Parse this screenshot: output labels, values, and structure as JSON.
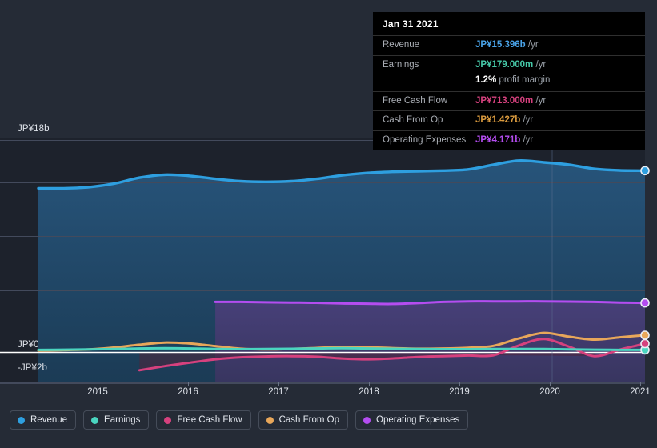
{
  "chart_data": {
    "type": "area",
    "title": "",
    "currency_prefix": "JP¥",
    "xlabel": "",
    "ylabel": "",
    "grid": true,
    "legend_position": "bottom-left",
    "x_tick_labels": [
      "2015",
      "2016",
      "2017",
      "2018",
      "2019",
      "2020",
      "2021"
    ],
    "y_tick_labels": [
      "JP¥18b",
      "JP¥0",
      "-JP¥2b"
    ],
    "ylim": [
      -2,
      18
    ],
    "y_unit": "JP¥ billions",
    "series": [
      {
        "name": "Revenue",
        "color": "#2e9fe0",
        "end_value": 15.396,
        "end_value_label": "JP¥15.396b",
        "values": [
          13.9,
          13.9,
          14.0,
          14.3,
          14.8,
          15.05,
          14.95,
          14.7,
          14.5,
          14.45,
          14.5,
          14.7,
          15.0,
          15.2,
          15.3,
          15.35,
          15.4,
          15.5,
          15.9,
          16.25,
          16.1,
          15.9,
          15.55,
          15.42,
          15.396
        ]
      },
      {
        "name": "Earnings",
        "color": "#4ad5c0",
        "end_value": 0.179,
        "end_value_label": "JP¥179.000m",
        "values": [
          0.18,
          0.2,
          0.22,
          0.25,
          0.3,
          0.32,
          0.3,
          0.26,
          0.24,
          0.25,
          0.27,
          0.3,
          0.32,
          0.3,
          0.27,
          0.25,
          0.24,
          0.24,
          0.25,
          0.26,
          0.25,
          0.22,
          0.2,
          0.18,
          0.179
        ]
      },
      {
        "name": "Free Cash Flow",
        "color": "#d6417e",
        "end_value": 0.713,
        "end_value_label": "JP¥713.000m",
        "start_x_index": 4,
        "values": [
          null,
          null,
          null,
          null,
          -1.55,
          -1.2,
          -0.9,
          -0.62,
          -0.45,
          -0.38,
          -0.35,
          -0.4,
          -0.55,
          -0.62,
          -0.55,
          -0.42,
          -0.35,
          -0.3,
          -0.28,
          0.55,
          1.1,
          0.45,
          -0.35,
          0.2,
          0.713
        ]
      },
      {
        "name": "Cash From Op",
        "color": "#e8a75a",
        "end_value": 1.427,
        "end_value_label": "JP¥1.427b",
        "values": [
          0.12,
          0.16,
          0.22,
          0.38,
          0.62,
          0.8,
          0.72,
          0.5,
          0.28,
          0.22,
          0.26,
          0.34,
          0.42,
          0.4,
          0.33,
          0.28,
          0.3,
          0.36,
          0.52,
          1.15,
          1.62,
          1.3,
          1.05,
          1.25,
          1.427
        ]
      },
      {
        "name": "Operating Expenses",
        "color": "#b44df0",
        "end_value": 4.171,
        "end_value_label": "JP¥4.171b",
        "start_x_index": 7,
        "values": [
          null,
          null,
          null,
          null,
          null,
          null,
          null,
          4.25,
          4.25,
          4.22,
          4.2,
          4.18,
          4.12,
          4.1,
          4.08,
          4.15,
          4.25,
          4.3,
          4.3,
          4.3,
          4.3,
          4.28,
          4.25,
          4.2,
          4.171
        ]
      }
    ]
  },
  "tooltip": {
    "title": "Jan 31 2021",
    "rows": [
      {
        "label": "Revenue",
        "amount": "JP¥15.396b",
        "unit": "/yr",
        "color": "#4aa3e8"
      },
      {
        "label": "Earnings",
        "amount": "JP¥179.000m",
        "unit": "/yr",
        "color": "#46c8a8"
      },
      {
        "label": "Free Cash Flow",
        "amount": "JP¥713.000m",
        "unit": "/yr",
        "color": "#d6417e"
      },
      {
        "label": "Cash From Op",
        "amount": "JP¥1.427b",
        "unit": "/yr",
        "color": "#d99a3e"
      },
      {
        "label": "Operating Expenses",
        "amount": "JP¥4.171b",
        "unit": "/yr",
        "color": "#b44df0"
      }
    ],
    "profit_margin": {
      "amount": "1.2%",
      "label": "profit margin"
    }
  },
  "legend": {
    "items": [
      {
        "label": "Revenue",
        "color": "#2e9fe0"
      },
      {
        "label": "Earnings",
        "color": "#4ad5c0"
      },
      {
        "label": "Free Cash Flow",
        "color": "#d6417e"
      },
      {
        "label": "Cash From Op",
        "color": "#e8a75a"
      },
      {
        "label": "Operating Expenses",
        "color": "#b44df0"
      }
    ]
  },
  "axes": {
    "y_top_label": "JP¥18b",
    "y_zero_label": "JP¥0",
    "y_bottom_label": "-JP¥2b",
    "x_labels": [
      "2015",
      "2016",
      "2017",
      "2018",
      "2019",
      "2020",
      "2021"
    ]
  },
  "colors": {
    "background": "#252b36",
    "plot_background": "#1d222c",
    "revenue_fill": "#1f4360",
    "opex_fill": "#3d3a63",
    "zero_line": "#ffffff",
    "gridline": "#40475a"
  }
}
